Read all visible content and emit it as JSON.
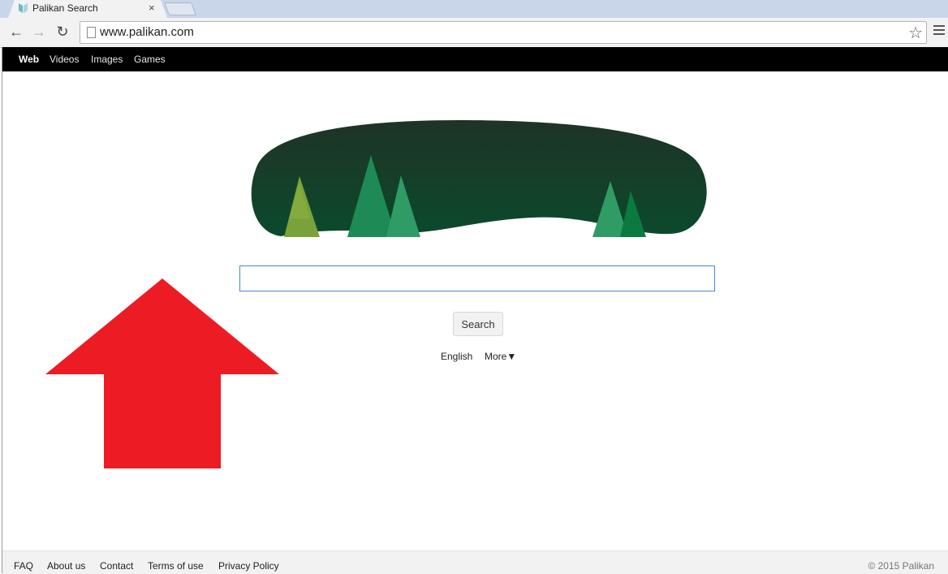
{
  "browser": {
    "tab_title": "Palikan Search",
    "tab_close": "×",
    "url": "www.palikan.com",
    "back_icon": "←",
    "forward_icon": "→",
    "reload_icon": "↻",
    "star_icon": "☆"
  },
  "topnav": {
    "items": [
      {
        "label": "Web",
        "active": true
      },
      {
        "label": "Videos"
      },
      {
        "label": "Images"
      },
      {
        "label": "Games"
      }
    ]
  },
  "search": {
    "value": "",
    "button_label": "Search",
    "language": "English",
    "more": "More▼"
  },
  "footer": {
    "links": [
      "FAQ",
      "About us",
      "Contact",
      "Terms of use",
      "Privacy Policy"
    ],
    "copyright": "© 2015 Palikan"
  },
  "colors": {
    "arrow": "#ed1c24",
    "logo_top": "#1f3326",
    "logo_bottom": "#0b4a2c",
    "tree_light": "#79a33a",
    "tree_green": "#1e8a56"
  }
}
